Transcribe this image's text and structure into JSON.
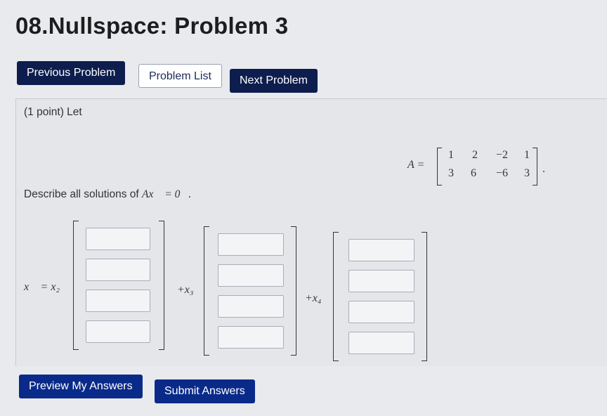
{
  "page": {
    "title": "08.Nullspace: Problem 3"
  },
  "nav": {
    "prev_label": "Previous Problem",
    "list_label": "Problem List",
    "next_label": "Next Problem"
  },
  "problem": {
    "points": "(1 point) Let",
    "matrix_label": "A =",
    "matrix": [
      [
        "1",
        "2",
        "−2",
        "1"
      ],
      [
        "3",
        "6",
        "−6",
        "3"
      ]
    ],
    "matrix_suffix": ".",
    "prompt_text": "Describe all solutions of ",
    "prompt_math": "Ax⃗ = 0⃗.",
    "solution_lhs": "x⃗ = x₂",
    "coef_3": "+x₃",
    "coef_4": "+x₄",
    "answers": [
      [
        "",
        "",
        "",
        ""
      ],
      [
        "",
        "",
        "",
        ""
      ],
      [
        "",
        "",
        "",
        ""
      ]
    ]
  },
  "actions": {
    "preview_label": "Preview My Answers",
    "submit_label": "Submit Answers"
  }
}
